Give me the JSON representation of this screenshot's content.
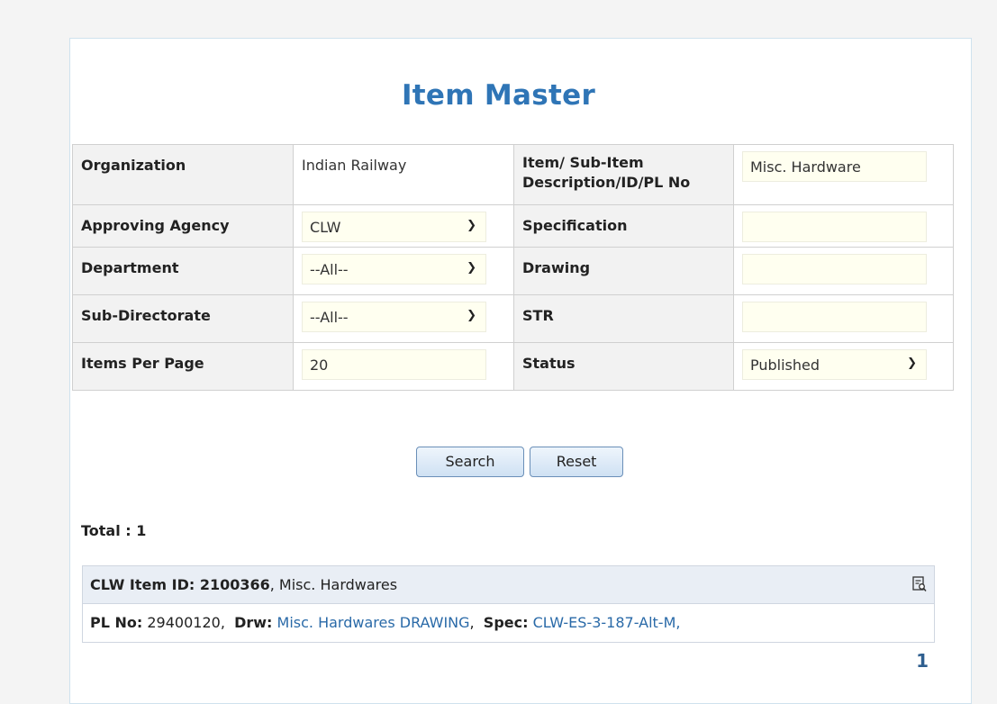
{
  "page": {
    "title": "Item Master"
  },
  "form": {
    "organization_label": "Organization",
    "organization_value": "Indian Railway",
    "item_desc_label": "Item/ Sub-Item Description/ID/PL No",
    "item_desc_value": "Misc. Hardware",
    "approving_agency_label": "Approving Agency",
    "approving_agency_value": "CLW",
    "specification_label": "Specification",
    "specification_value": "",
    "department_label": "Department",
    "department_value": "--All--",
    "drawing_label": "Drawing",
    "drawing_value": "",
    "sub_directorate_label": "Sub-Directorate",
    "sub_directorate_value": "--All--",
    "str_label": "STR",
    "str_value": "",
    "items_per_page_label": "Items Per Page",
    "items_per_page_value": "20",
    "status_label": "Status",
    "status_value": "Published"
  },
  "actions": {
    "search_label": "Search",
    "reset_label": "Reset"
  },
  "results": {
    "total_label": "Total : 1",
    "item_id_label": "CLW Item ID: 2100366",
    "item_name": "Misc. Hardwares",
    "pl_label": "PL No:",
    "pl_value": "29400120",
    "drw_label": "Drw:",
    "drw_value": "Misc. Hardwares DRAWING",
    "spec_label": "Spec:",
    "spec_value": "CLW-ES-3-187-Alt-M",
    "view_icon": "view-details-icon"
  },
  "pagination": {
    "current_page": "1"
  },
  "colors": {
    "accent": "#2f75b6",
    "link": "#2a6aa8",
    "input_bg": "#fffff0"
  }
}
